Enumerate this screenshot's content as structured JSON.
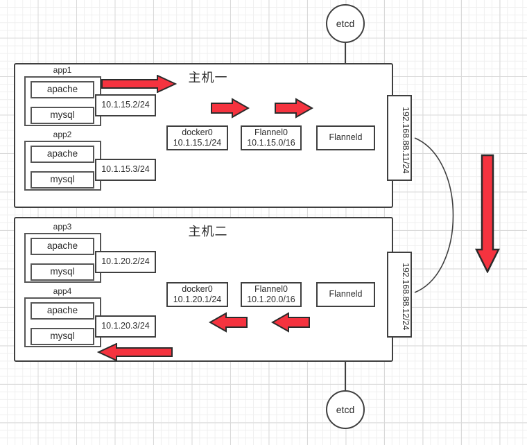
{
  "diagram": {
    "title_host1": "主机一",
    "title_host2": "主机二",
    "etcd_top_label": "etcd",
    "etcd_bottom_label": "etcd",
    "accent_color": "#f5333f",
    "line_color": "#3f3f3f"
  },
  "host1": {
    "apps": [
      {
        "name": "app1",
        "services": [
          "apache",
          "mysql"
        ],
        "ip": "10.1.15.2/24"
      },
      {
        "name": "app2",
        "services": [
          "apache",
          "mysql"
        ],
        "ip": "10.1.15.3/24"
      }
    ],
    "docker0": {
      "name": "docker0",
      "ip": "10.1.15.1/24"
    },
    "flannel0": {
      "name": "Flannel0",
      "ip": "10.1.15.0/16"
    },
    "flanneld": {
      "name": "Flanneld"
    },
    "nic": {
      "ip": "192.168.88.11/24"
    }
  },
  "host2": {
    "apps": [
      {
        "name": "app3",
        "services": [
          "apache",
          "mysql"
        ],
        "ip": "10.1.20.2/24"
      },
      {
        "name": "app4",
        "services": [
          "apache",
          "mysql"
        ],
        "ip": "10.1.20.3/24"
      }
    ],
    "docker0": {
      "name": "docker0",
      "ip": "10.1.20.1/24"
    },
    "flannel0": {
      "name": "Flannel0",
      "ip": "10.1.20.0/16"
    },
    "flanneld": {
      "name": "Flanneld"
    },
    "nic": {
      "ip": "192.168.88.12/24"
    }
  }
}
